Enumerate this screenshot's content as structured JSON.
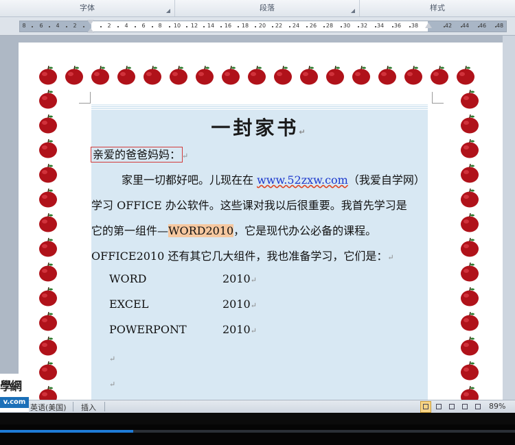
{
  "ribbon": {
    "groups": [
      "字体",
      "段落",
      "样式"
    ]
  },
  "ruler": {
    "labels": [
      "8",
      "6",
      "4",
      "2",
      "2",
      "4",
      "6",
      "8",
      "10",
      "12",
      "14",
      "16",
      "18",
      "20",
      "22",
      "24",
      "26",
      "28",
      "30",
      "32",
      "34",
      "36",
      "38",
      "42",
      "44",
      "46",
      "48"
    ]
  },
  "document": {
    "title": "一封家书",
    "greeting": "亲爱的爸爸妈妈：",
    "p1_before": "家里一切都好吧。儿现在在 ",
    "p1_link": "www.52zxw.com",
    "p1_after": "（我爱自学网）",
    "line2": "学习 OFFICE 办公软件。这些课对我以后很重要。我首先学习是",
    "line3_before": "它的第一组件—",
    "line3_hl": "WORD2010",
    "line3_after": "，它是现代办公必备的课程。",
    "line4": "OFFICE2010 还有其它几大组件，我也准备学习，它们是：",
    "components": [
      {
        "name": "WORD",
        "version": "2010"
      },
      {
        "name": "EXCEL",
        "version": "2010"
      },
      {
        "name": "POWERPONT",
        "version": "2010"
      }
    ],
    "para_mark": "↵"
  },
  "watermark": {
    "cn": "學網",
    "en": "v.com"
  },
  "statusbar": {
    "language": "英语(美国)",
    "mode": "插入",
    "zoom": "89%"
  },
  "colors": {
    "text_bg": "#d8e8f3",
    "apple": "#b0121a",
    "highlight": "#f6c8a0",
    "progress": "#1e7bd6"
  }
}
